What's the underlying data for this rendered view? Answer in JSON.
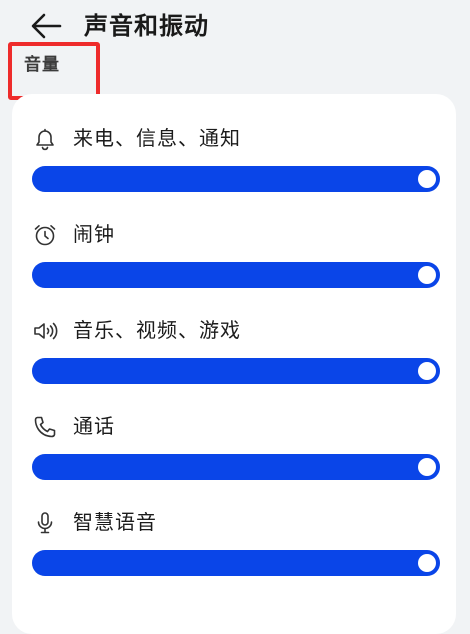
{
  "header": {
    "title": "声音和振动",
    "back_icon": "arrow-left-icon"
  },
  "section": {
    "label": "音量"
  },
  "colors": {
    "accent": "#0a45e8",
    "highlight_border": "#ee2b2b",
    "background": "#f1f3f5",
    "card": "#ffffff"
  },
  "volumes": [
    {
      "id": "ringtone",
      "label": "来电、信息、通知",
      "icon": "bell-icon",
      "level": 1.0
    },
    {
      "id": "alarm",
      "label": "闹钟",
      "icon": "alarm-clock-icon",
      "level": 1.0
    },
    {
      "id": "media",
      "label": "音乐、视频、游戏",
      "icon": "speaker-icon",
      "level": 1.0
    },
    {
      "id": "call",
      "label": "通话",
      "icon": "phone-icon",
      "level": 1.0
    },
    {
      "id": "assistant",
      "label": "智慧语音",
      "icon": "microphone-icon",
      "level": 1.0
    }
  ]
}
